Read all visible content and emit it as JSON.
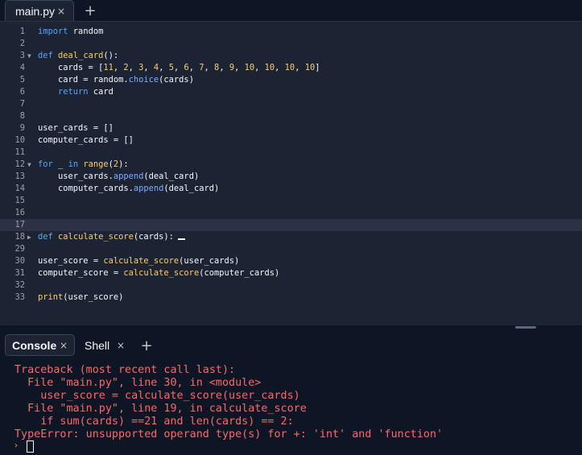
{
  "editor_tab": {
    "label": "main.py",
    "close": "×",
    "add": "+"
  },
  "code_lines": [
    {
      "num": "1",
      "fold": "",
      "html": "<span class=\"kw\">import</span> random"
    },
    {
      "num": "2",
      "fold": "",
      "html": ""
    },
    {
      "num": "3",
      "fold": "▼",
      "html": "<span class=\"kw\">def</span> <span class=\"fn\">deal_card</span>():"
    },
    {
      "num": "4",
      "fold": "",
      "html": "    cards = [<span class=\"num\">11</span>, <span class=\"num\">2</span>, <span class=\"num\">3</span>, <span class=\"num\">4</span>, <span class=\"num\">5</span>, <span class=\"num\">6</span>, <span class=\"num\">7</span>, <span class=\"num\">8</span>, <span class=\"num\">9</span>, <span class=\"num\">10</span>, <span class=\"num\">10</span>, <span class=\"num\">10</span>, <span class=\"num\">10</span>]"
    },
    {
      "num": "5",
      "fold": "",
      "html": "    card = random.<span class=\"attr\">choice</span>(cards)"
    },
    {
      "num": "6",
      "fold": "",
      "html": "    <span class=\"kw\">return</span> card"
    },
    {
      "num": "7",
      "fold": "",
      "html": ""
    },
    {
      "num": "8",
      "fold": "",
      "html": ""
    },
    {
      "num": "9",
      "fold": "",
      "html": "user_cards = []"
    },
    {
      "num": "10",
      "fold": "",
      "html": "computer_cards = []"
    },
    {
      "num": "11",
      "fold": "",
      "html": ""
    },
    {
      "num": "12",
      "fold": "▼",
      "html": "<span class=\"kw\">for</span> _ <span class=\"kw\">in</span> <span class=\"fn\">range</span>(<span class=\"num\">2</span>):"
    },
    {
      "num": "13",
      "fold": "",
      "html": "    user_cards.<span class=\"attr\">append</span>(deal_card)"
    },
    {
      "num": "14",
      "fold": "",
      "html": "    computer_cards.<span class=\"attr\">append</span>(deal_card)"
    },
    {
      "num": "15",
      "fold": "",
      "html": ""
    },
    {
      "num": "16",
      "fold": "",
      "html": ""
    },
    {
      "num": "17",
      "fold": "",
      "html": "",
      "current": true
    },
    {
      "num": "18",
      "fold": "▶",
      "html": "<span class=\"kw\">def</span> <span class=\"fn\">calculate_score</span>(cards):<span class=\"ellipsis\"></span>"
    },
    {
      "num": "29",
      "fold": "",
      "html": ""
    },
    {
      "num": "30",
      "fold": "",
      "html": "user_score = <span class=\"fn\">calculate_score</span>(user_cards)"
    },
    {
      "num": "31",
      "fold": "",
      "html": "computer_score = <span class=\"fn\">calculate_score</span>(computer_cards)"
    },
    {
      "num": "32",
      "fold": "",
      "html": ""
    },
    {
      "num": "33",
      "fold": "",
      "html": "<span class=\"fn\">print</span>(user_score)"
    }
  ],
  "console_tabs": {
    "console": {
      "label": "Console",
      "close": "×"
    },
    "shell": {
      "label": "Shell",
      "close": "×"
    },
    "add": "+"
  },
  "console_output": [
    "Traceback (most recent call last):",
    "  File \"main.py\", line 30, in <module>",
    "    user_score = calculate_score(user_cards)",
    "  File \"main.py\", line 19, in calculate_score",
    "    if sum(cards) ==21 and len(cards) == 2:",
    "TypeError: unsupported operand type(s) for +: 'int' and 'function'"
  ],
  "console_prompt": "›"
}
